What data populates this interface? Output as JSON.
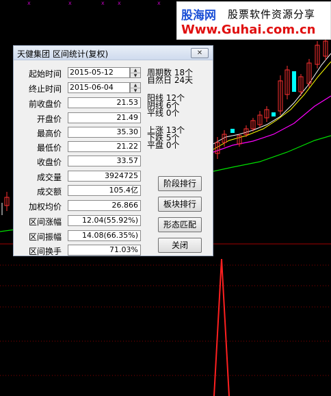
{
  "watermark": {
    "logo": "股海网",
    "slogan": "股票软件资源分享",
    "url": "Www.Guhai.com.cn"
  },
  "colors": {
    "up": "#ff3030",
    "down": "#00ffff",
    "ma_white": "#ffffff",
    "ma_yellow": "#ffff00",
    "ma_magenta": "#ff00ff",
    "ma_green": "#00ff00",
    "spike": "#ff2020",
    "grid": "#c00000"
  },
  "dialog": {
    "title": "天健集团 区间统计(复权)",
    "close_icon": "close-x-icon",
    "start_label": "起始时间",
    "start_value": "2015-05-12",
    "end_label": "终止时间",
    "end_value": "2015-06-04",
    "rows": [
      {
        "label": "前收盘价",
        "value": "21.53"
      },
      {
        "label": "开盘价",
        "value": "21.49"
      },
      {
        "label": "最高价",
        "value": "35.30"
      },
      {
        "label": "最低价",
        "value": "21.22"
      },
      {
        "label": "收盘价",
        "value": "33.57"
      },
      {
        "label": "成交量",
        "value": "3924725"
      },
      {
        "label": "成交额",
        "value": "105.4亿"
      },
      {
        "label": "加权均价",
        "value": "26.866"
      },
      {
        "label": "区间涨幅",
        "value": "12.04(55.92%)"
      },
      {
        "label": "区间振幅",
        "value": "14.08(66.35%)"
      },
      {
        "label": "区间换手",
        "value": "71.03%"
      }
    ],
    "stats": {
      "period_count": "周期数 18个",
      "natural_days": "自然日 24天",
      "yang": "阳线 12个",
      "yin": "阴线 6个",
      "flat_line": "平线 0个",
      "rise": "上涨 13个",
      "fall": "下跌 5个",
      "flat": "平盘 0个"
    },
    "buttons": {
      "stage_rank": "阶段排行",
      "sector_rank": "板块排行",
      "pattern_match": "形态匹配",
      "close": "关闭"
    }
  }
}
